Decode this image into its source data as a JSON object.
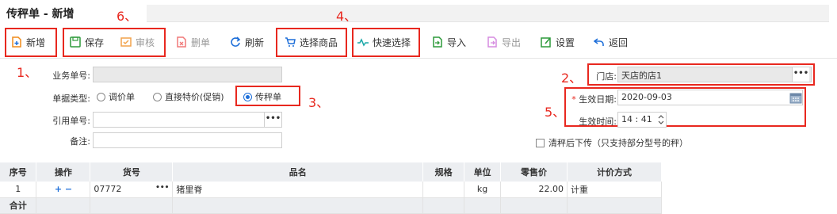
{
  "window": {
    "title": "传秤单 - 新增"
  },
  "toolbar": {
    "items": [
      {
        "key": "add",
        "label": "新增",
        "icon": "new-doc-icon",
        "enabled": true
      },
      {
        "key": "save",
        "label": "保存",
        "icon": "save-icon",
        "enabled": true
      },
      {
        "key": "audit",
        "label": "审核",
        "icon": "approve-icon",
        "enabled": false
      },
      {
        "key": "delete",
        "label": "删单",
        "icon": "delete-doc-icon",
        "enabled": false
      },
      {
        "key": "refresh",
        "label": "刷新",
        "icon": "refresh-icon",
        "enabled": true
      },
      {
        "key": "select_goods",
        "label": "选择商品",
        "icon": "cart-icon",
        "enabled": true
      },
      {
        "key": "quick_select",
        "label": "快速选择",
        "icon": "pulse-icon",
        "enabled": true
      },
      {
        "key": "import",
        "label": "导入",
        "icon": "import-icon",
        "enabled": true
      },
      {
        "key": "export",
        "label": "导出",
        "icon": "export-icon",
        "enabled": false
      },
      {
        "key": "settings",
        "label": "设置",
        "icon": "edit-settings-icon",
        "enabled": true
      },
      {
        "key": "back",
        "label": "返回",
        "icon": "back-arrow-icon",
        "enabled": true
      }
    ]
  },
  "annotations": {
    "n1": "1、",
    "n2": "2、",
    "n3": "3、",
    "n4": "4、",
    "n5": "5、",
    "n6": "6、"
  },
  "form": {
    "doc_no_label": "业务单号:",
    "doc_no_value": "",
    "doc_type_label": "单据类型:",
    "doc_types": [
      "调价单",
      "直接特价(促销)",
      "传秤单"
    ],
    "doc_type_selected": "传秤单",
    "ref_no_label": "引用单号:",
    "ref_no_value": "",
    "remark_label": "备注:",
    "remark_value": "",
    "store_label": "门店:",
    "store_value": "天店的店1",
    "effective_date_label": "生效日期:",
    "effective_date_value": "2020-09-03",
    "effective_time_label": "生效时间:",
    "effective_time_value": "14 : 41",
    "clear_scale_label": "清秤后下传（只支持部分型号的秤）"
  },
  "grid": {
    "columns": [
      "序号",
      "操作",
      "货号",
      "品名",
      "规格",
      "单位",
      "零售价",
      "计价方式"
    ],
    "rows": [
      {
        "seq": "1",
        "ops": "+ −",
        "code": "07772",
        "name": "猪里脊",
        "spec": "",
        "unit": "kg",
        "price": "22.00",
        "pricing": "计重"
      }
    ],
    "total_label": "合计"
  },
  "colors": {
    "accent": "#1e6fd9",
    "annotation": "#e8281f",
    "header_bg": "#eceef1"
  }
}
